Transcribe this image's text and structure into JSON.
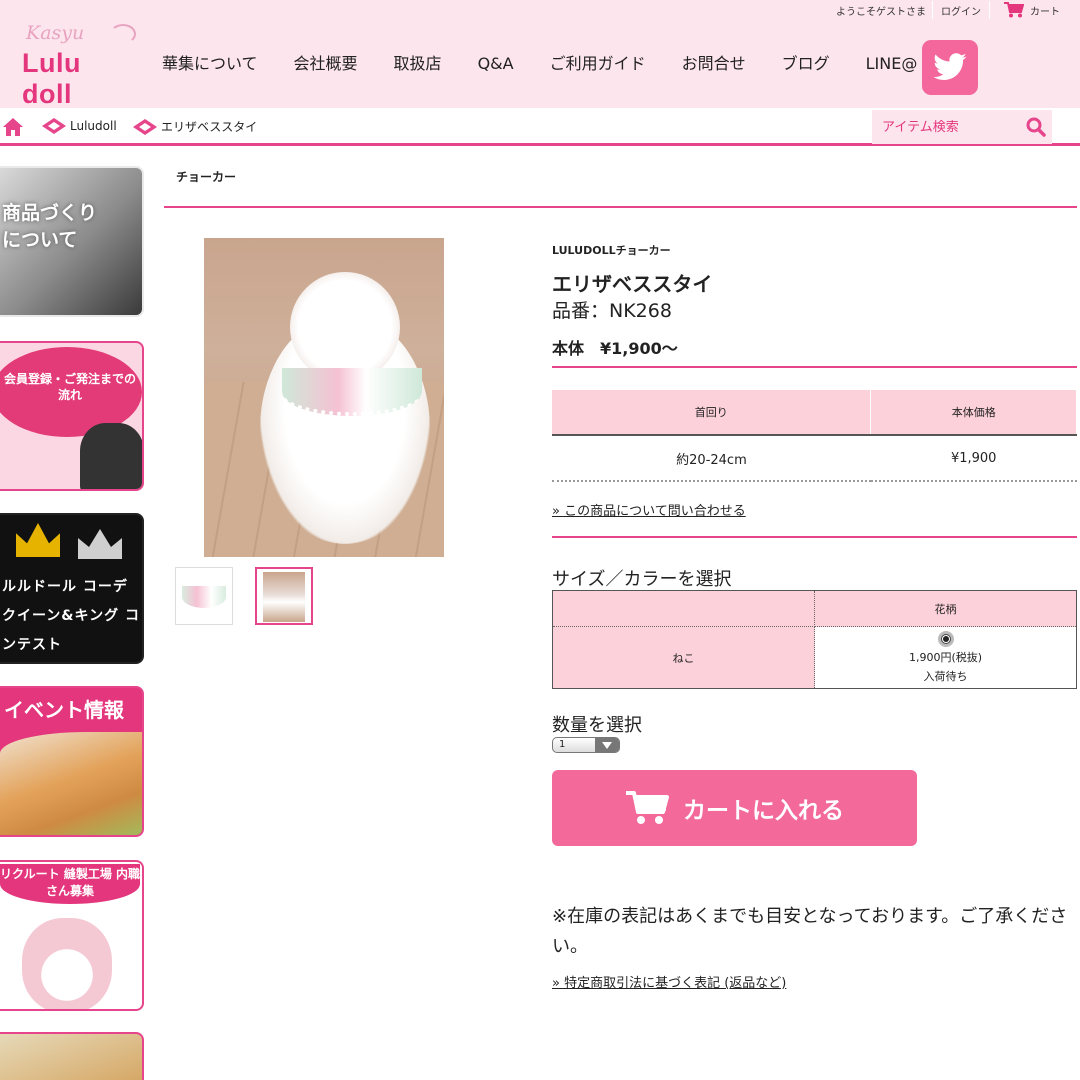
{
  "header": {
    "logo_script": "Kasyu",
    "logo_main": "Lulu doll",
    "welcome": "ようこそゲストさま",
    "login": "ログイン",
    "cart": "カート",
    "nav": [
      "華集について",
      "会社概要",
      "取扱店",
      "Q&A",
      "ご利用ガイド",
      "お問合せ",
      "ブログ",
      "LINE@"
    ],
    "twitter_icon": "twitter-bird-icon",
    "accent": "#e4367c",
    "bg": "#fde5ee"
  },
  "breadcrumb": {
    "items": [
      "Luludoll",
      "エリザベススタイ"
    ]
  },
  "search": {
    "placeholder": "アイテム検索"
  },
  "sidebar": {
    "banners": [
      {
        "text": "商品づくり について"
      },
      {
        "text": "会員登録・ご発注までの 流れ"
      },
      {
        "text": "ルルドール コーデ クイーン&キング コンテスト"
      },
      {
        "text": "イベント情報"
      },
      {
        "text": "リクルート 縫製工場 内職さん募集"
      }
    ]
  },
  "product": {
    "category": "チョーカー",
    "brand": "LULUDOLLチョーカー",
    "name": "エリザベススタイ",
    "code": "品番：NK268",
    "price": "本体　¥1,900〜",
    "size_table": {
      "headers": [
        "首回り",
        "本体価格"
      ],
      "rows": [
        [
          "約20-24cm",
          "¥1,900"
        ]
      ]
    },
    "inquire_link": "» この商品について問い合わせる",
    "select_heading": "サイズ／カラーを選択",
    "variant": {
      "col_header": "花柄",
      "row_header": "ねこ",
      "price": "1,900円(税抜)",
      "status": "入荷待ち"
    },
    "qty_heading": "数量を選択",
    "qty_value": "1",
    "cart_button": "カートに入れる",
    "stock_note": "※在庫の表記はあくまでも目安となっております。ご了承ください。",
    "law_link": "» 特定商取引法に基づく表記 (返品など)"
  }
}
